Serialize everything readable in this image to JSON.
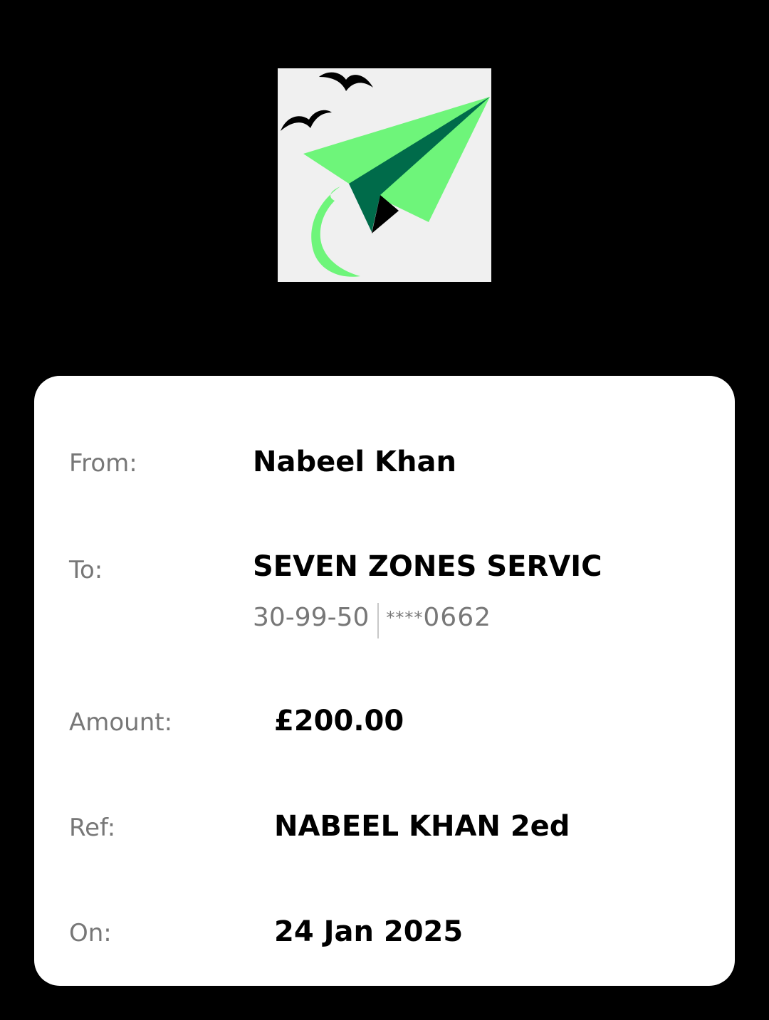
{
  "logo": {
    "icon": "paper-plane-birds-logo",
    "colors": {
      "background": "#f0f0f0",
      "plane_light": "#6ef57a",
      "plane_dark": "#006b4a",
      "birds": "#000000"
    }
  },
  "transfer": {
    "from_label": "From:",
    "from_value": "Nabeel Khan",
    "to_label": "To:",
    "to_value": "SEVEN ZONES SERVIC",
    "sort_code": "30-99-50",
    "account_stars": "****",
    "account_digits": "0662",
    "amount_label": "Amount:",
    "amount_value": "£200.00",
    "ref_label": "Ref:",
    "ref_value": "NABEEL KHAN 2ed",
    "on_label": "On:",
    "on_value": "24 Jan 2025"
  }
}
